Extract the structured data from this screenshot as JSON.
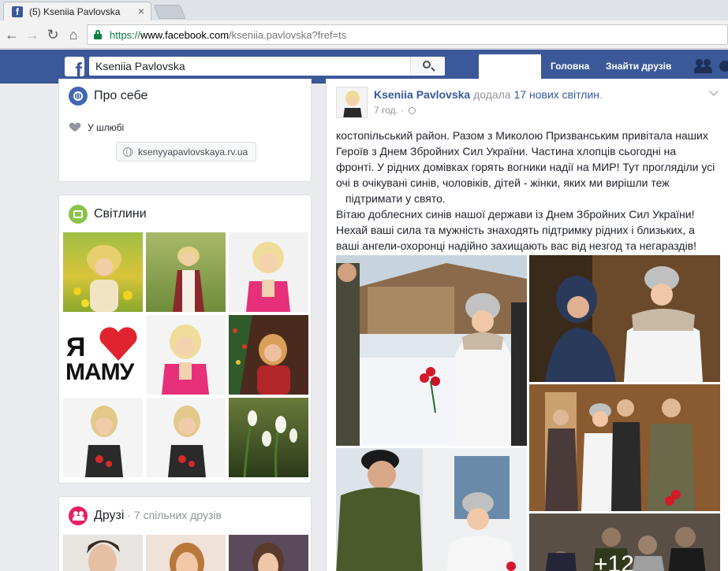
{
  "browser": {
    "tab_title": "(5) Kseniia Pavlovska",
    "tab_favicon_letter": "f",
    "url": {
      "scheme": "https://",
      "host": "www.facebook.com",
      "path": "/kseniia.pavlovska?fref=ts"
    },
    "icons": [
      "back-icon",
      "forward-icon",
      "reload-icon",
      "home-icon",
      "lock-icon",
      "close-icon"
    ]
  },
  "fb_header": {
    "logo_letter": "f",
    "search_value": "Kseniia Pavlovska",
    "nav_home": "Головна",
    "nav_find_friends": "Знайти друзів"
  },
  "about": {
    "title": "Про себе",
    "relationship": "У шлюбі",
    "website": "ksenyyapavlovskaya.rv.ua"
  },
  "photos": {
    "title": "Світлини",
    "logo_text_top": "Я",
    "logo_text_bottom": "МАМУ"
  },
  "friends": {
    "title": "Друзі",
    "subtitle": " · 7 спільних друзів"
  },
  "post": {
    "author": "Kseniia Pavlovska",
    "action": " додала ",
    "photo_count": "17 нових світлин",
    "period": ".",
    "time": "7 год. · ",
    "text_lines": [
      "костопільський район. Разом з Миколою Призванським привітала наших",
      "Героїв з Днем Збройних Сил України. Частина хлопців сьогодні на",
      "фронті. У рідних домівках горять вогники надії на МИР! Тут прогляділи усі",
      "очі в очікувані синів, чоловіків, дітей - жінки, яких ми вирішли теж",
      "підтримати у свято.",
      "Вітаю доблесних синів нашої держави із Днем Збройних Сил України!",
      "Нехай ваші сила та мужність знаходять підтримку рідних і близьких, а",
      "ваші ангели-охоронці надійно захищають вас від незгод та негараздів!"
    ],
    "more_photos_label": "+12"
  },
  "colors": {
    "fb_blue": "#3b5998",
    "link_blue": "#365899",
    "page_bg": "#e9ebee",
    "secure_green": "#0b8043"
  }
}
